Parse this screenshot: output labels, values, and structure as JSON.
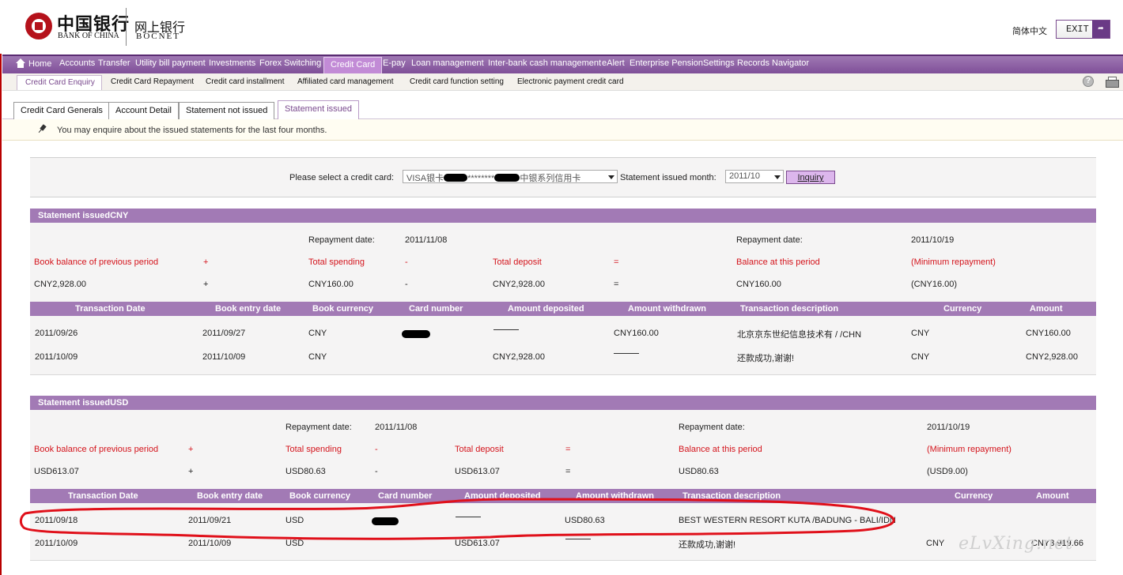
{
  "header": {
    "logo_cn": "中国银行",
    "logo_en": "BANK OF CHINA",
    "brand_cn": "网上银行",
    "brand_en": "BOCNET",
    "language": "简体中文",
    "exit_label": "EXIT"
  },
  "main_nav": [
    "Home",
    "Accounts",
    "Transfer",
    "Utility bill payment",
    "Investments",
    "Forex Switching",
    "Credit Card",
    "E-pay",
    "Loan management",
    "Inter-bank cash management",
    "eAlert",
    "Enterprise Pension",
    "Settings",
    "Records",
    "Navigator"
  ],
  "sub_nav": [
    "Credit Card Enquiry",
    "Credit Card Repayment",
    "Credit card installment",
    "Affiliated card management",
    "Credit card function setting",
    "Electronic payment credit card"
  ],
  "tabs": [
    "Credit Card Generals",
    "Account Detail",
    "Statement not issued",
    "Statement issued"
  ],
  "info_text": "You may enquire about the issued statements for the last four months.",
  "search": {
    "card_label": "Please select a credit card:",
    "card_prefix": "VISA银卡",
    "card_mask": "********",
    "card_suffix": "中银系列信用卡",
    "month_label": "Statement issued month:",
    "month_value": "2011/10",
    "inquiry_label": "Inquiry"
  },
  "summary_labels": {
    "repayment_date": "Repayment date:",
    "prev_balance": "Book balance of previous period",
    "plus": "+",
    "total_spending": "Total spending",
    "minus": "-",
    "total_deposit": "Total deposit",
    "equals": "=",
    "balance": "Balance at this period",
    "min_repayment": "(Minimum repayment)"
  },
  "columns": [
    "Transaction Date",
    "Book entry date",
    "Book currency",
    "Card number",
    "Amount deposited",
    "Amount withdrawn",
    "Transaction description",
    "Currency",
    "Amount"
  ],
  "cny": {
    "title": "Statement issuedCNY",
    "repayment_date_1": "2011/11/08",
    "repayment_date_2": "2011/10/19",
    "prev_balance": "CNY2,928.00",
    "total_spending": "CNY160.00",
    "total_deposit": "CNY2,928.00",
    "balance": "CNY160.00",
    "min_repayment": "(CNY16.00)",
    "rows": [
      {
        "txn_date": "2011/09/26",
        "book_date": "2011/09/27",
        "book_currency": "CNY",
        "deposited": "",
        "withdrawn": "CNY160.00",
        "description": "北京京东世纪信息技术有 / /CHN",
        "currency": "CNY",
        "amount": "CNY160.00"
      },
      {
        "txn_date": "2011/10/09",
        "book_date": "2011/10/09",
        "book_currency": "CNY",
        "deposited": "CNY2,928.00",
        "withdrawn": "",
        "description": "还款成功,谢谢!",
        "currency": "CNY",
        "amount": "CNY2,928.00"
      }
    ]
  },
  "usd": {
    "title": "Statement issuedUSD",
    "repayment_date_1": "2011/11/08",
    "repayment_date_2": "2011/10/19",
    "prev_balance": "USD613.07",
    "total_spending": "USD80.63",
    "total_deposit": "USD613.07",
    "balance": "USD80.63",
    "min_repayment": "(USD9.00)",
    "rows": [
      {
        "txn_date": "2011/09/18",
        "book_date": "2011/09/21",
        "book_currency": "USD",
        "deposited": "",
        "withdrawn": "USD80.63",
        "description": "BEST WESTERN RESORT KUTA /BADUNG - BALI/IDN",
        "currency": "",
        "amount": ""
      },
      {
        "txn_date": "2011/10/09",
        "book_date": "2011/10/09",
        "book_currency": "USD",
        "deposited": "USD613.07",
        "withdrawn": "",
        "description": "还款成功,谢谢!",
        "currency": "CNY",
        "amount": "CNY3,919.66"
      }
    ]
  },
  "watermark": "eLvXing.net",
  "colors": {
    "brand_red": "#b5121b",
    "purple_header": "#a27ab5",
    "red_text": "#d4141c",
    "highlight": "#e0101a"
  }
}
